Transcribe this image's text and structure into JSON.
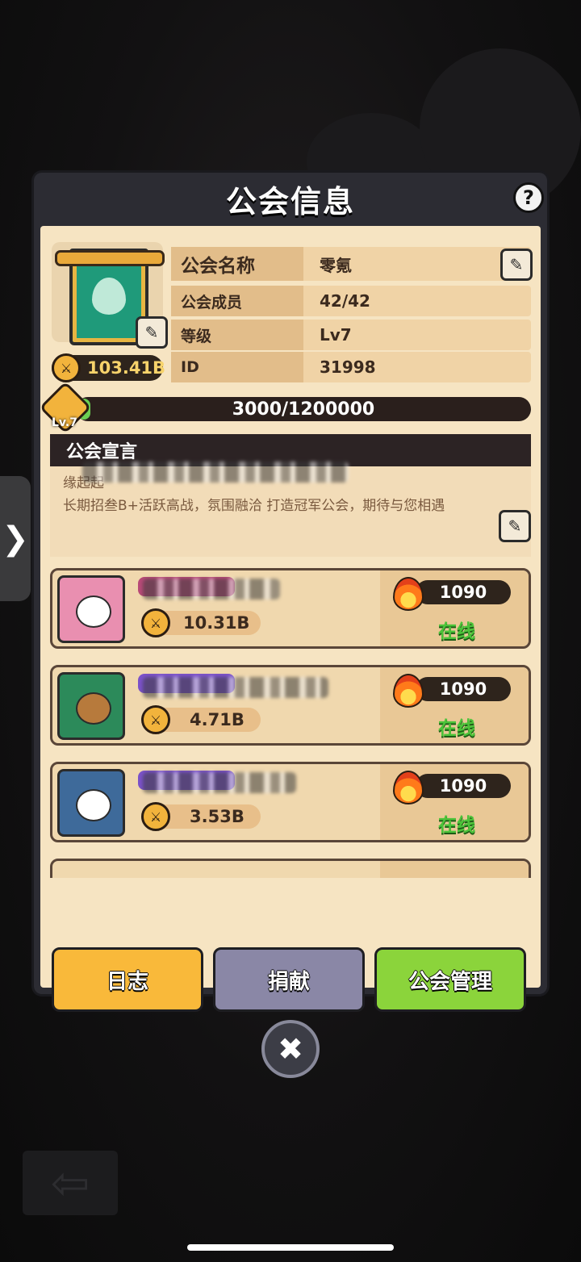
{
  "title": "公会信息",
  "help_label": "?",
  "guild": {
    "power": "103.41B",
    "name_key": "公会名称",
    "name_val": "零氪",
    "members_key": "公会成员",
    "members_val": "42/42",
    "level_key": "等级",
    "level_val": "Lv7",
    "id_key": "ID",
    "id_val": "31998",
    "xp": "3000/1200000",
    "xp_fraction": 0.0025,
    "level_badge": "Lv.7"
  },
  "declaration": {
    "header": "公会宣言",
    "line1": "缘起起",
    "line2": "长期招叁B+活跃高战，氛围融洽   打造冠军公会，期待与您相遇"
  },
  "members": [
    {
      "power": "10.31B",
      "fire": "1090",
      "status": "在线",
      "tag_color": "#b84a78"
    },
    {
      "power": "4.71B",
      "fire": "1090",
      "status": "在线",
      "tag_color": "#7b52c9"
    },
    {
      "power": "3.53B",
      "fire": "1090",
      "status": "在线",
      "tag_color": "#7b52c9"
    }
  ],
  "buttons": {
    "log": "日志",
    "donate": "捐献",
    "manage": "公会管理"
  },
  "close_label": "✖",
  "side_tab_label": "❯",
  "back_label": "⇦",
  "colors": {
    "online": "#4cc33a",
    "log_btn": "#f9b93a",
    "donate_btn": "#8a87a6",
    "manage_btn": "#8bd43b"
  }
}
